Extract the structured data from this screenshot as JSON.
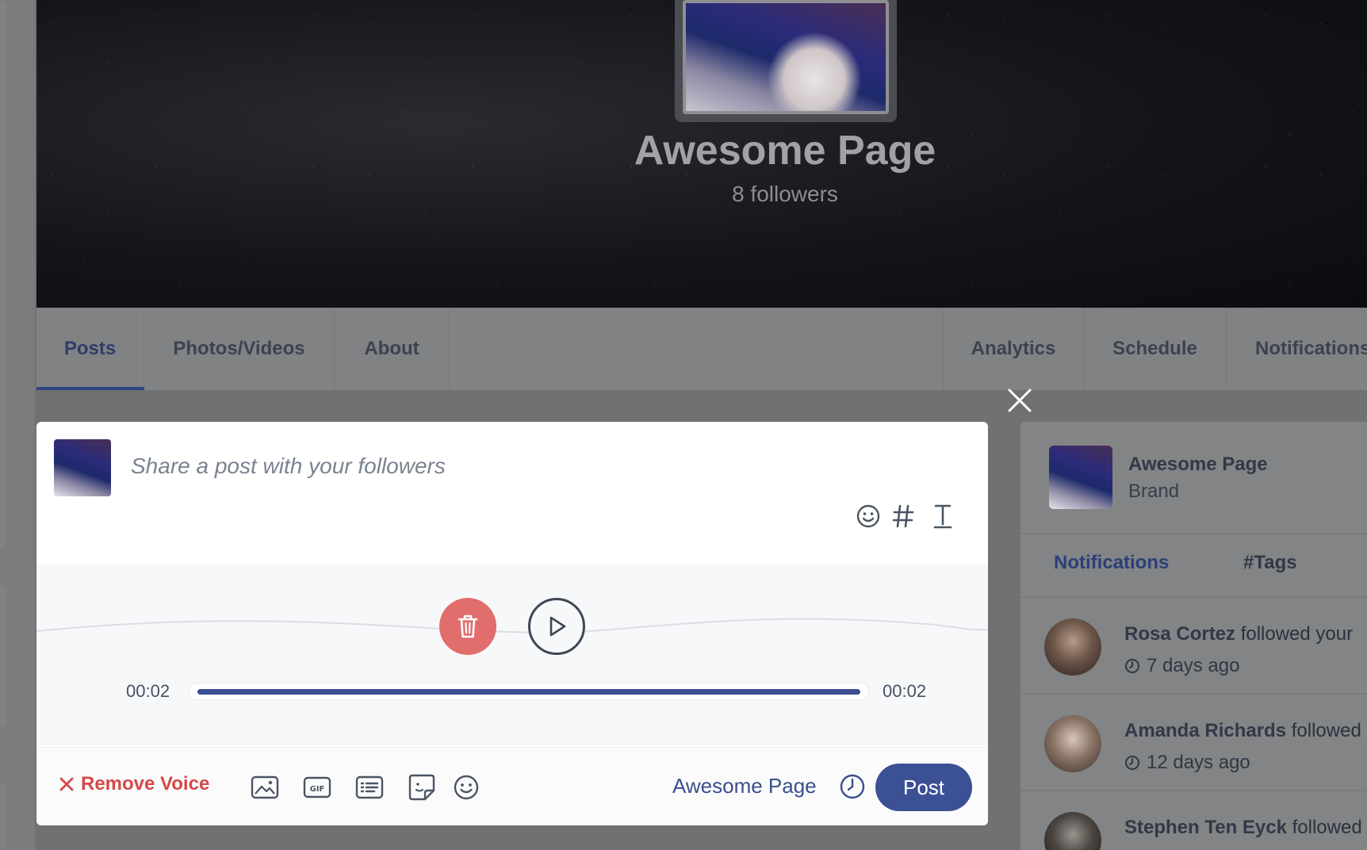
{
  "page": {
    "name": "Awesome Page",
    "followers": "8 followers"
  },
  "tabs": [
    {
      "label": "Posts",
      "active": true
    },
    {
      "label": "Photos/Videos",
      "active": false
    },
    {
      "label": "About",
      "active": false
    },
    {
      "label": "Analytics",
      "active": false
    },
    {
      "label": "Schedule",
      "active": false
    },
    {
      "label": "Notifications",
      "active": false
    }
  ],
  "composer": {
    "placeholder": "Share a post with your followers",
    "voice": {
      "elapsed": "00:02",
      "duration": "00:02",
      "progress": 1.0
    },
    "remove_voice_label": "Remove Voice",
    "page_select": "Awesome Page",
    "post_label": "Post",
    "colors": {
      "accent": "#3c5096",
      "danger": "#d54848",
      "delete_button": "#e26d6d"
    }
  },
  "sidebar": {
    "page_name": "Awesome Page",
    "page_type": "Brand",
    "tabs": [
      {
        "label": "Notifications",
        "active": true
      },
      {
        "label": "#Tags",
        "active": false
      }
    ],
    "notifications": [
      {
        "name": "Rosa Cortez",
        "text": " followed your",
        "time": "7 days ago"
      },
      {
        "name": "Amanda Richards",
        "text": " followed",
        "time": "12 days ago"
      },
      {
        "name": "Stephen Ten Eyck",
        "text": " followed",
        "time": ""
      }
    ]
  }
}
